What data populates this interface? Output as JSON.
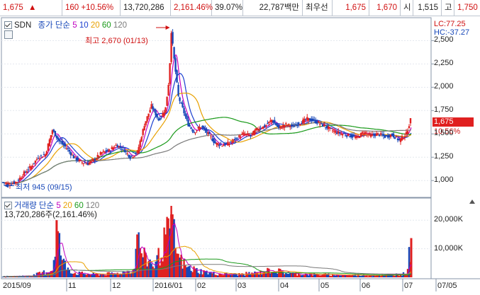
{
  "quote_bar": {
    "price": "1,675",
    "arrow": "▲",
    "change": "160 +10.56%",
    "volume": "13,720,286",
    "volume_ratio": "2,161.46%",
    "turnover_pct": "39.07%",
    "trade_value": "22,787백만",
    "best_quote_label": "최우선",
    "best_ask": "1,675",
    "best_bid": "1,670",
    "open_label": "시",
    "open": "1,515",
    "high_label": "고",
    "high": "1,750"
  },
  "price_panel": {
    "ticker": "SDN",
    "ma_label": "종가 단순",
    "ma_periods": [
      "5",
      "10",
      "20",
      "60",
      "120"
    ],
    "ma_colors": [
      "#c000c0",
      "#1b3fd0",
      "#e8a000",
      "#1a9a1a",
      "#7a7a7a"
    ],
    "lc": "LC:77.25",
    "hc": "HC:-37.27",
    "max_annotation": "최고 2,670 (01/13)",
    "min_annotation": "최저 945 (09/15)",
    "current_price": "1,675",
    "current_change": "10.56%",
    "y_ticks": [
      "2,500",
      "2,250",
      "2,000",
      "1,750",
      "1,500",
      "1,250",
      "1,000"
    ]
  },
  "volume_panel": {
    "label": "거래량 단순",
    "ma_periods": [
      "5",
      "20",
      "60",
      "120"
    ],
    "ma_colors": [
      "#c000c0",
      "#e8a000",
      "#1a9a1a",
      "#7a7a7a"
    ],
    "value": "13,720,286주(2,161.46%)",
    "y_ticks": [
      "20,000K",
      "10,000K"
    ]
  },
  "x_axis": [
    "2015/09",
    "11",
    "12",
    "2016/01",
    "02",
    "03",
    "04",
    "05",
    "06",
    "07",
    "07/05"
  ],
  "chart_data": {
    "type": "candlestick",
    "price_ylim": [
      850,
      2700
    ],
    "volume_ylim": [
      0,
      25000
    ],
    "max_point": {
      "date": "01/13",
      "price": 2670
    },
    "min_point": {
      "date": "09/15",
      "price": 945
    },
    "anchors_price": [
      [
        0,
        980
      ],
      [
        10,
        960
      ],
      [
        20,
        990
      ],
      [
        30,
        1080
      ],
      [
        40,
        1150
      ],
      [
        50,
        1250
      ],
      [
        60,
        1280
      ],
      [
        70,
        1540
      ],
      [
        80,
        1420
      ],
      [
        90,
        1350
      ],
      [
        100,
        1250
      ],
      [
        110,
        1200
      ],
      [
        120,
        1180
      ],
      [
        130,
        1230
      ],
      [
        140,
        1300
      ],
      [
        150,
        1320
      ],
      [
        160,
        1380
      ],
      [
        170,
        1340
      ],
      [
        180,
        1250
      ],
      [
        190,
        1300
      ],
      [
        200,
        1600
      ],
      [
        210,
        1800
      ],
      [
        220,
        1650
      ],
      [
        225,
        1700
      ],
      [
        230,
        1780
      ],
      [
        235,
        2100
      ],
      [
        238,
        2600
      ],
      [
        242,
        2300
      ],
      [
        248,
        1900
      ],
      [
        255,
        1750
      ],
      [
        262,
        1600
      ],
      [
        270,
        1520
      ],
      [
        280,
        1580
      ],
      [
        290,
        1500
      ],
      [
        300,
        1400
      ],
      [
        310,
        1380
      ],
      [
        320,
        1400
      ],
      [
        330,
        1450
      ],
      [
        340,
        1500
      ],
      [
        350,
        1480
      ],
      [
        360,
        1560
      ],
      [
        370,
        1580
      ],
      [
        380,
        1650
      ],
      [
        390,
        1560
      ],
      [
        400,
        1600
      ],
      [
        410,
        1580
      ],
      [
        420,
        1620
      ],
      [
        430,
        1660
      ],
      [
        440,
        1640
      ],
      [
        450,
        1600
      ],
      [
        460,
        1560
      ],
      [
        470,
        1520
      ],
      [
        480,
        1500
      ],
      [
        490,
        1480
      ],
      [
        500,
        1460
      ],
      [
        510,
        1520
      ],
      [
        520,
        1480
      ],
      [
        530,
        1500
      ],
      [
        540,
        1470
      ],
      [
        550,
        1490
      ],
      [
        560,
        1430
      ],
      [
        570,
        1500
      ],
      [
        577,
        1675
      ]
    ],
    "anchors_volume": [
      [
        0,
        400
      ],
      [
        40,
        600
      ],
      [
        70,
        3000
      ],
      [
        76,
        20000
      ],
      [
        85,
        6000
      ],
      [
        100,
        1800
      ],
      [
        130,
        1200
      ],
      [
        160,
        1500
      ],
      [
        185,
        3000
      ],
      [
        190,
        15000
      ],
      [
        200,
        8000
      ],
      [
        215,
        5000
      ],
      [
        230,
        15000
      ],
      [
        238,
        22000
      ],
      [
        248,
        8000
      ],
      [
        260,
        4000
      ],
      [
        280,
        2500
      ],
      [
        300,
        1500
      ],
      [
        330,
        1200
      ],
      [
        360,
        1800
      ],
      [
        380,
        3000
      ],
      [
        410,
        1500
      ],
      [
        440,
        1200
      ],
      [
        470,
        1000
      ],
      [
        500,
        900
      ],
      [
        540,
        900
      ],
      [
        570,
        1500
      ],
      [
        577,
        13720
      ]
    ]
  }
}
